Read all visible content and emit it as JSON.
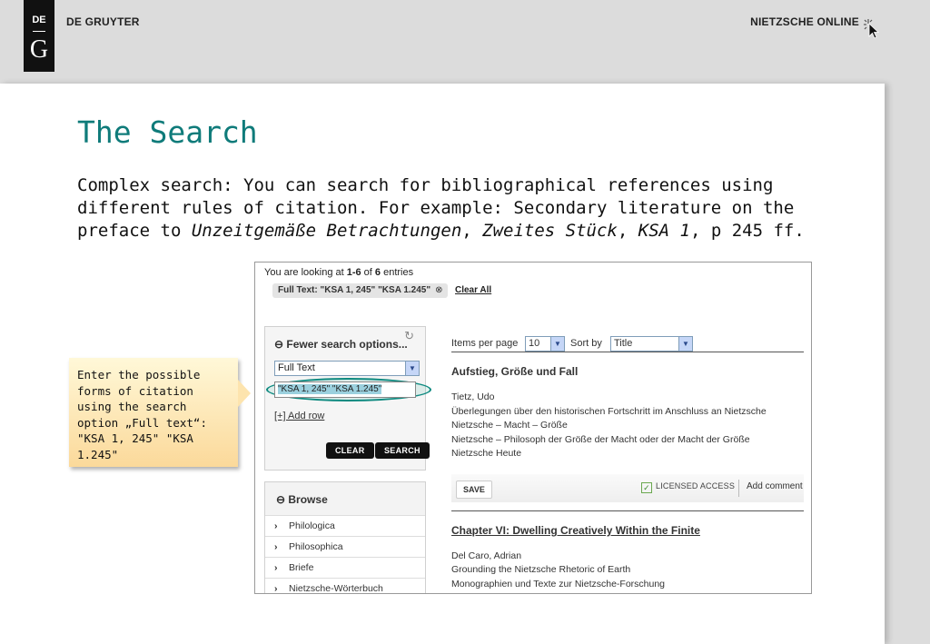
{
  "header": {
    "logo_top": "DE",
    "logo_letter": "G",
    "publisher": "DE GRUYTER",
    "product": "NIETZSCHE ONLINE"
  },
  "slide": {
    "title": "The Search",
    "body_plain": "Complex search: You can search for bibliographical references using different rules of citation. For example: Secondary literature on the preface to ",
    "body_italic_1": "Unzeitgemäße Betrachtungen",
    "body_sep_1": ", ",
    "body_italic_2": "Zweites Stück",
    "body_sep_2": ", ",
    "body_italic_3": "KSA 1",
    "body_tail": ", p 245 ff."
  },
  "callout": {
    "text": "Enter the possible forms of citation using the search option „Full text“: \"KSA 1, 245\" \"KSA 1.245\""
  },
  "screenshot": {
    "entries_prefix": "You are looking at ",
    "entries_range": "1-6",
    "entries_of": " of ",
    "entries_total": "6",
    "entries_suffix": " entries",
    "filter_chip": "Full Text: \"KSA 1, 245\" \"KSA 1.245\"",
    "clear_all": "Clear All",
    "search_panel": {
      "toggle": "⊖ Fewer search options...",
      "field_value": "Full Text",
      "query_value": "\"KSA 1, 245\" \"KSA 1.245\"",
      "add_row": "[+] Add row",
      "clear_label": "CLEAR",
      "search_label": "SEARCH"
    },
    "browse": {
      "title": "⊖ Browse",
      "items": [
        "Philologica",
        "Philosophica",
        "Briefe",
        "Nietzsche-Wörterbuch"
      ]
    },
    "toolbar": {
      "items_per_page_label": "Items per page",
      "items_per_page_value": "10",
      "sort_label": "Sort by",
      "sort_value": "Title"
    },
    "results": [
      {
        "title": "Aufstieg, Größe und Fall",
        "lines": [
          "Tietz, Udo",
          "Überlegungen über den historischen Fortschritt im Anschluss an Nietzsche",
          "Nietzsche – Macht – Größe",
          "Nietzsche – Philosoph der Größe der Macht oder der Macht der Größe",
          "Nietzsche Heute"
        ]
      },
      {
        "title": "Chapter VI: Dwelling Creatively Within the Finite",
        "lines": [
          "Del Caro, Adrian",
          "Grounding the Nietzsche Rhetoric of Earth",
          "Monographien und Texte zur Nietzsche-Forschung"
        ]
      }
    ],
    "actions": {
      "save": "SAVE",
      "licensed": "LICENSED ACCESS",
      "add_comment": "Add comment"
    }
  }
}
